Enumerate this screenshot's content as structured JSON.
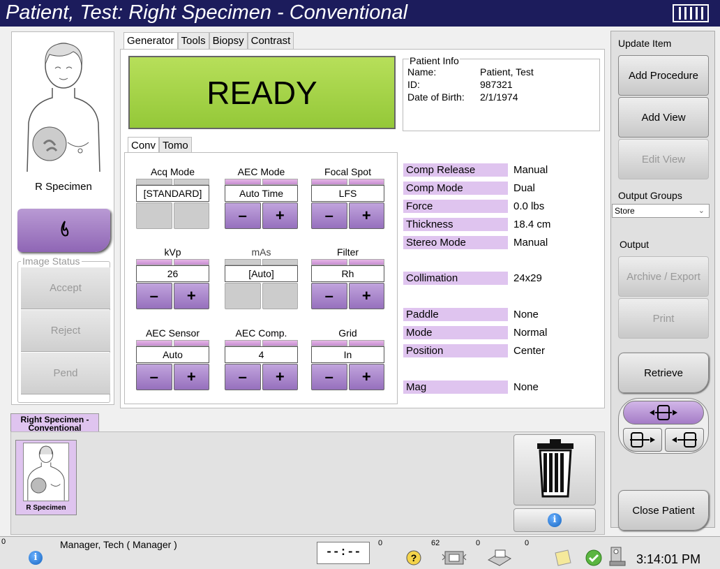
{
  "title": "Patient, Test:  Right Specimen - Conventional",
  "left": {
    "view_label": "R Specimen",
    "image_status_label": "Image Status",
    "accept": "Accept",
    "reject": "Reject",
    "pend": "Pend"
  },
  "tabs": [
    "Generator",
    "Tools",
    "Biopsy",
    "Contrast"
  ],
  "ready": "READY",
  "patient": {
    "header": "Patient Info",
    "name_label": "Name:",
    "name": "Patient, Test",
    "id_label": "ID:",
    "id": "987321",
    "dob_label": "Date of Birth:",
    "dob": "2/1/1974"
  },
  "subtabs": [
    "Conv",
    "Tomo"
  ],
  "controls": {
    "acq_mode": {
      "label": "Acq Mode",
      "value": "[STANDARD]"
    },
    "aec_mode": {
      "label": "AEC Mode",
      "value": "Auto Time"
    },
    "focal_spot": {
      "label": "Focal Spot",
      "value": "LFS"
    },
    "kvp": {
      "label": "kVp",
      "value": "26"
    },
    "mas": {
      "label": "mAs",
      "value": "[Auto]"
    },
    "filter": {
      "label": "Filter",
      "value": "Rh"
    },
    "aec_sensor": {
      "label": "AEC Sensor",
      "value": "Auto"
    },
    "aec_comp": {
      "label": "AEC Comp.",
      "value": "4"
    },
    "grid": {
      "label": "Grid",
      "value": "In"
    },
    "minus": "–",
    "plus": "+"
  },
  "params": {
    "comp_release": {
      "label": "Comp Release",
      "value": "Manual"
    },
    "comp_mode": {
      "label": "Comp Mode",
      "value": "Dual"
    },
    "force": {
      "label": "Force",
      "value": "0.0 lbs"
    },
    "thickness": {
      "label": "Thickness",
      "value": "18.4 cm"
    },
    "stereo_mode": {
      "label": "Stereo Mode",
      "value": "Manual"
    },
    "collimation": {
      "label": "Collimation",
      "value": "24x29"
    },
    "paddle": {
      "label": "Paddle",
      "value": "None"
    },
    "mode": {
      "label": "Mode",
      "value": "Normal"
    },
    "position": {
      "label": "Position",
      "value": "Center"
    },
    "mag": {
      "label": "Mag",
      "value": "None"
    }
  },
  "right": {
    "update_item": "Update Item",
    "add_procedure": "Add Procedure",
    "add_view": "Add View",
    "edit_view": "Edit View",
    "output_groups": "Output Groups",
    "output_group_value": "Store",
    "output": "Output",
    "archive_export": "Archive / Export",
    "print": "Print",
    "retrieve": "Retrieve",
    "close_patient": "Close Patient"
  },
  "thumbnails": {
    "tab_label": "Right Specimen - Conventional",
    "thumb_label": "R Specimen"
  },
  "status": {
    "count_left": "0",
    "user": "Manager, Tech ( Manager )",
    "lock": "--:--",
    "c1": "0",
    "c2": "62",
    "c3": "0",
    "c4": "0",
    "time": "3:14:01 PM"
  }
}
